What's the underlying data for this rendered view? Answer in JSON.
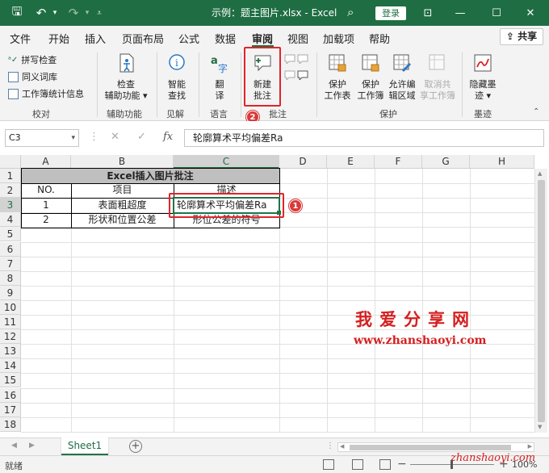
{
  "titlebar": {
    "title": "示例：题主图片.xlsx  -  Excel",
    "login": "登录",
    "icons": [
      "save-icon",
      "undo-icon",
      "redo-icon",
      "customize-icon",
      "search-icon",
      "ribbon-display-icon",
      "minimize-icon",
      "maximize-icon",
      "close-icon"
    ]
  },
  "menu": {
    "tabs": [
      "文件",
      "开始",
      "插入",
      "页面布局",
      "公式",
      "数据",
      "审阅",
      "视图",
      "加载项",
      "帮助"
    ],
    "active": "审阅",
    "share": "共享"
  },
  "ribbon": {
    "proofing": {
      "spell": "拼写检查",
      "thesaurus": "同义词库",
      "stats": "工作簿统计信息",
      "label": "校对"
    },
    "accessibility": {
      "button": "检查辅助功能",
      "btn_line1": "检查",
      "btn_line2": "辅助功能",
      "label": "辅助功能"
    },
    "insights": {
      "btn_line1": "智能",
      "btn_line2": "查找",
      "label": "见解"
    },
    "language": {
      "btn_line1": "翻",
      "btn_line2": "译",
      "label": "语言"
    },
    "comments": {
      "btn_line1": "新建",
      "btn_line2": "批注",
      "label": "批注"
    },
    "protect": {
      "sheet": [
        "保护",
        "工作表"
      ],
      "workbook": [
        "保护",
        "工作簿"
      ],
      "ranges": [
        "允许编",
        "辑区域"
      ],
      "unshare": [
        "取消共",
        "享工作簿"
      ],
      "label": "保护"
    },
    "ink": {
      "btn_line1": "隐藏墨",
      "btn_line2": "迹",
      "label": "墨迹"
    }
  },
  "formula_bar": {
    "name_box": "C3",
    "formula": "轮廓算术平均偏差Ra",
    "fx": "fx"
  },
  "grid": {
    "columns": [
      "A",
      "B",
      "C",
      "D",
      "E",
      "F",
      "G",
      "H"
    ],
    "rows": [
      "1",
      "2",
      "3",
      "4",
      "5",
      "6",
      "7",
      "8",
      "9",
      "10",
      "11",
      "12",
      "13",
      "14",
      "15",
      "16",
      "17",
      "18"
    ],
    "table_title": "Excel插入图片批注",
    "headers": [
      "NO.",
      "项目",
      "描述"
    ],
    "data": [
      [
        "1",
        "表面粗超度",
        "轮廓算术平均偏差Ra"
      ],
      [
        "2",
        "形状和位置公差",
        "形位公差的符号"
      ]
    ]
  },
  "annotations": {
    "badge1": "1",
    "badge2": "2"
  },
  "watermark": {
    "line1": "我爱分享网",
    "line2": "www.zhanshaoyi.com",
    "line3": "zhanshaoyi.com"
  },
  "sheets": {
    "tabs": [
      "Sheet1"
    ]
  },
  "status": {
    "ready": "就绪",
    "zoom": "100%"
  },
  "colors": {
    "excel_green": "#1f6e43",
    "highlight_red": "#e0252a"
  }
}
